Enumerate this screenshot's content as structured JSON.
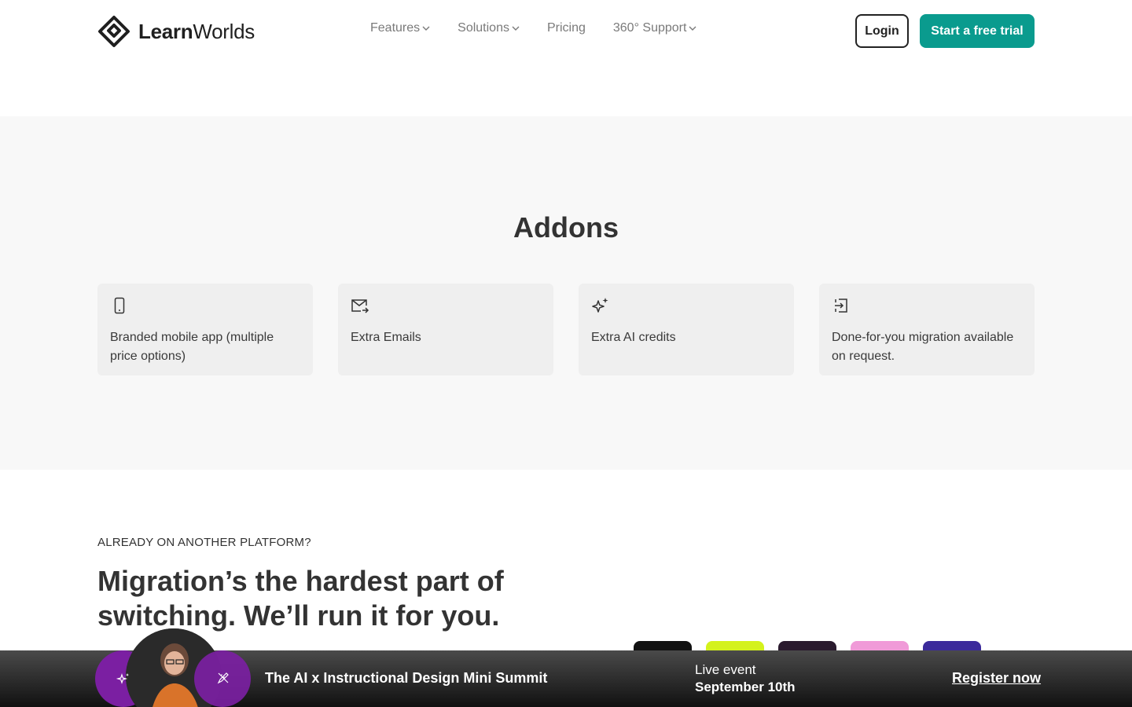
{
  "header": {
    "logo_text_bold": "Learn",
    "logo_text_regular": "Worlds",
    "nav": [
      {
        "label": "Features"
      },
      {
        "label": "Solutions"
      },
      {
        "label": "Pricing"
      },
      {
        "label": "360° Support"
      }
    ],
    "login_label": "Login",
    "trial_label": "Start a free trial",
    "accent_color": "#0a9b8e"
  },
  "addons": {
    "title": "Addons",
    "cards": [
      {
        "icon": "mobile-phone-icon",
        "text": "Branded mobile app (multiple price options)"
      },
      {
        "icon": "mail-forward-icon",
        "text": "Extra Emails"
      },
      {
        "icon": "sparkles-icon",
        "text": "Extra AI credits"
      },
      {
        "icon": "sign-in-icon",
        "text": "Done-for-you migration available on request."
      }
    ]
  },
  "migration": {
    "eyebrow": "ALREADY ON ANOTHER PLATFORM?",
    "title": "Migration’s the hardest part of switching. We’ll run it for you.",
    "tile_colors": [
      "#111111",
      "#d4f21c",
      "#2a1a2e",
      "#f09ad8",
      "#3b2a9b"
    ]
  },
  "banner": {
    "title": "The AI x Instructional Design Mini Summit",
    "live_label": "Live event",
    "date": "September 10th",
    "register_label": "Register now",
    "circle_color": "#7b1fa2"
  }
}
